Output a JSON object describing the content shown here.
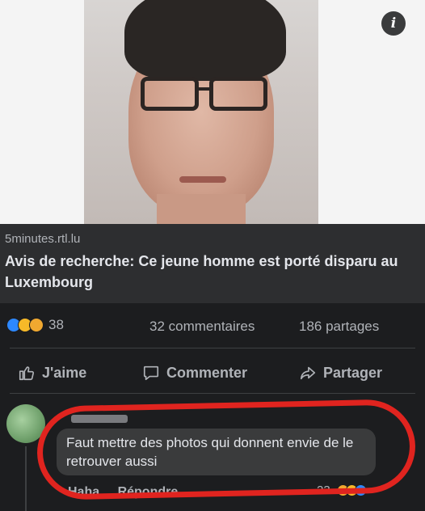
{
  "post": {
    "link": {
      "domain": "5minutes.rtl.lu",
      "headline": "Avis de recherche: Ce jeune homme est porté disparu au Luxembourg"
    },
    "info_icon": "i",
    "stats": {
      "reaction_icons": [
        "like-icon",
        "sad-icon",
        "care-icon"
      ],
      "reaction_count": "38",
      "comments": "32 commentaires",
      "shares": "186 partages"
    },
    "actions": {
      "like_label": "J'aime",
      "comment_label": "Commenter",
      "share_label": "Partager"
    }
  },
  "comment": {
    "text": "Faut mettre des photos qui donnent envie de le retrouver aussi",
    "like_label": "Haha",
    "reply_label": "Répondre",
    "reaction_count": "23"
  },
  "colors": {
    "background": "#1c1d1f",
    "link_box": "#2d2e30",
    "bubble": "#3a3b3c",
    "highlight": "#e0241f",
    "muted_text": "#b0b3b8"
  }
}
